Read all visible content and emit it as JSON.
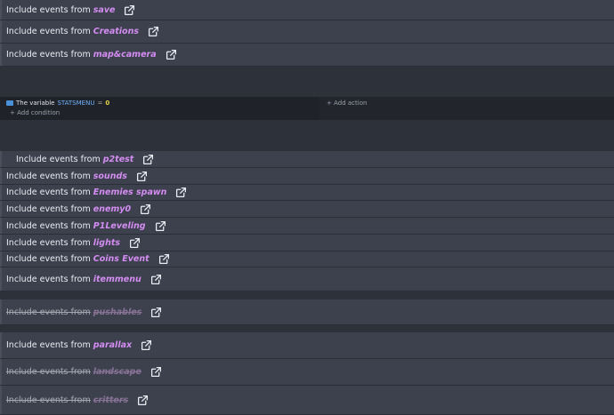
{
  "include_rows": [
    {
      "prefix": "Include events from",
      "name": "save",
      "disabled": false
    },
    {
      "prefix": "Include events from",
      "name": "Creations",
      "disabled": false
    },
    {
      "prefix": "Include events from",
      "name": "map&camera",
      "disabled": false
    },
    {
      "prefix": "Include events from",
      "name": "p2test",
      "disabled": false
    },
    {
      "prefix": "Include events from",
      "name": "sounds",
      "disabled": false
    },
    {
      "prefix": "Include events from",
      "name": "Enemies spawn",
      "disabled": false
    },
    {
      "prefix": "Include events from",
      "name": "enemy0",
      "disabled": false
    },
    {
      "prefix": "Include events from",
      "name": "P1Leveling",
      "disabled": false
    },
    {
      "prefix": "Include events from",
      "name": "lights",
      "disabled": false
    },
    {
      "prefix": "Include events from",
      "name": "Coins Event",
      "disabled": false
    },
    {
      "prefix": "Include events from",
      "name": "itemmenu",
      "disabled": false
    },
    {
      "prefix": "Include events from",
      "name": "pushables",
      "disabled": true
    },
    {
      "prefix": "Include events from",
      "name": "parallax",
      "disabled": false
    },
    {
      "prefix": "Include events from",
      "name": "landscape",
      "disabled": true
    },
    {
      "prefix": "Include events from",
      "name": "critters",
      "disabled": true
    }
  ],
  "condition": {
    "text": "The variable",
    "variable": "STATSMENU",
    "operator": "=",
    "value": "0",
    "add_condition": "+ Add condition",
    "add_action": "+ Add action"
  },
  "colors": {
    "extension_name": "#d48cf2",
    "row_background": "#3c414d",
    "variable_name": "#6fb2ff",
    "value": "#e6d34a"
  },
  "icons": {
    "open_link": "external-link-icon",
    "variable": "variable-icon"
  }
}
